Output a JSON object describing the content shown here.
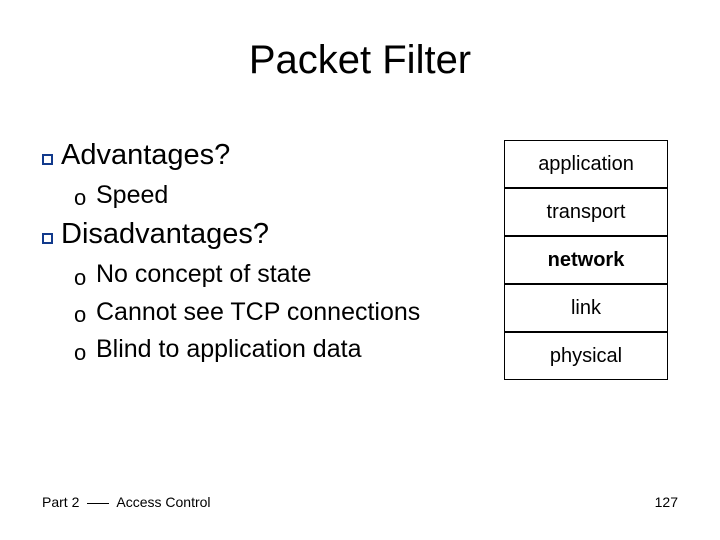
{
  "title": "Packet Filter",
  "bullets": {
    "advantages": {
      "label": "Advantages?",
      "items": [
        "Speed"
      ]
    },
    "disadvantages": {
      "label": "Disadvantages?",
      "items": [
        "No concept of state",
        "Cannot see TCP connections",
        "Blind to application data"
      ]
    }
  },
  "stack": {
    "layers": [
      "application",
      "transport",
      "network",
      "link",
      "physical"
    ],
    "bold_index": 2
  },
  "footer": {
    "part": "Part 2",
    "section": "Access Control",
    "page": "127"
  }
}
